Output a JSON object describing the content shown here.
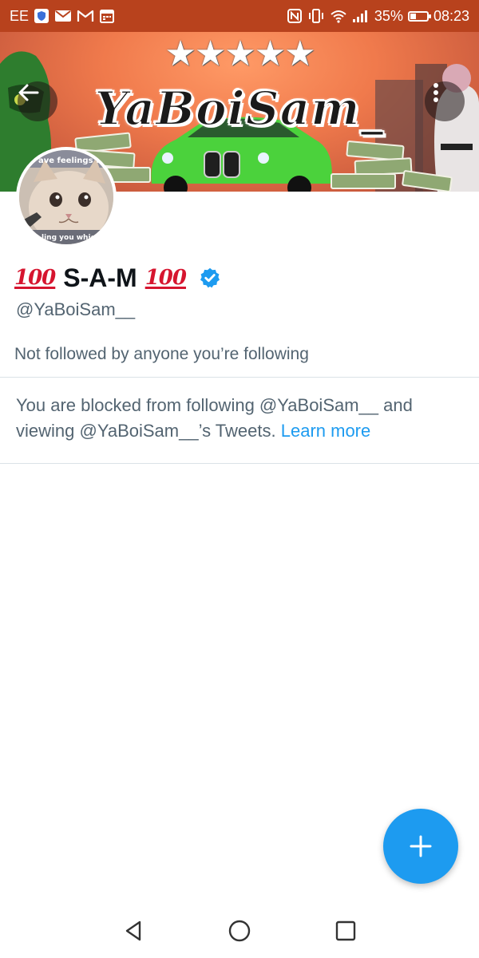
{
  "status_bar": {
    "carrier": "EE",
    "battery_percent": "35%",
    "battery_level": 0.35,
    "time": "08:23",
    "left_icons": [
      "shield-icon",
      "mail-icon",
      "gmail-icon",
      "calendar-icon"
    ],
    "right_icons": [
      "nfc-icon",
      "vibrate-icon",
      "wifi-icon",
      "signal-icon",
      "battery-icon"
    ],
    "background_color": "#b8421d"
  },
  "banner": {
    "title": "YaBoiSam_",
    "stars": "★★★★★"
  },
  "header": {
    "back_icon": "arrow-left-icon",
    "more_icon": "more-vertical-icon"
  },
  "profile": {
    "name_prefix_emoji": "100",
    "name": "S-A-M",
    "name_suffix_emoji": "100",
    "verified": true,
    "handle": "@YaBoiSam__",
    "followed_by_text": "Not followed by anyone you’re following",
    "avatar_caption_top": "ave feelings t",
    "avatar_caption_bottom": "ling you which"
  },
  "blocked_notice": {
    "text": "You are blocked from following @YaBoiSam__ and viewing @YaBoiSam__’s Tweets.",
    "link_label": "Learn more"
  },
  "compose_button": {
    "icon": "plus-icon",
    "color": "#1d9bf0"
  },
  "nav_bar": {
    "buttons": [
      "nav-back-icon",
      "nav-home-icon",
      "nav-recents-icon"
    ]
  },
  "colors": {
    "accent": "#1d9bf0",
    "secondary_text": "#536471",
    "primary_text": "#0f1419",
    "emoji_red": "#d6152f"
  }
}
